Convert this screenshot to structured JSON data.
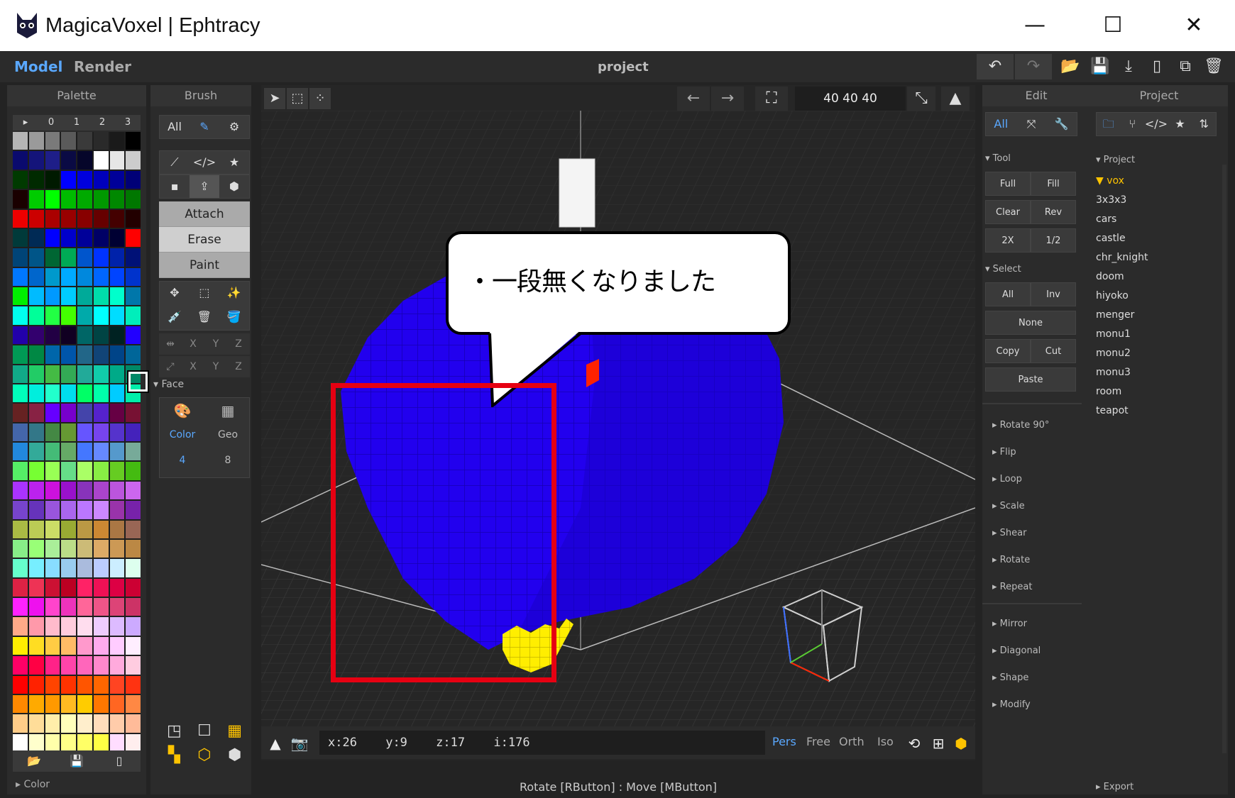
{
  "window": {
    "title": "MagicaVoxel | Ephtracy",
    "minimize": "—",
    "maximize": "☐",
    "close": "✕"
  },
  "menubar": {
    "tab_model": "Model",
    "tab_render": "Render",
    "project_name": "project"
  },
  "palette": {
    "title": "Palette",
    "header": [
      "▸",
      "0",
      "1",
      "2",
      "3"
    ],
    "color_label": "▸ Color",
    "swatches": [
      "#b5b5b5",
      "#9a9a9a",
      "#7a7a7a",
      "#5a5a5a",
      "#3a3a3a",
      "#2a2a2a",
      "#1a1a1a",
      "#000000",
      "#0a0a6e",
      "#14147a",
      "#1e1e88",
      "#0a0a44",
      "#06062a",
      "#ffffff",
      "#e6e6e6",
      "#cccccc",
      "#003a00",
      "#002a00",
      "#001a00",
      "#0000ff",
      "#0000dd",
      "#0000bb",
      "#000099",
      "#000077",
      "#1a0000",
      "#00cc00",
      "#00ff00",
      "#00bb00",
      "#00aa00",
      "#009900",
      "#008800",
      "#007700",
      "#ee0000",
      "#cc0000",
      "#aa0000",
      "#990000",
      "#880000",
      "#660000",
      "#440000",
      "#220000",
      "#003a3a",
      "#002a55",
      "#0000ff",
      "#0000cc",
      "#000099",
      "#000066",
      "#000033",
      "#ff0000",
      "#004477",
      "#005588",
      "#006633",
      "#00aa55",
      "#0055cc",
      "#0033ff",
      "#0022aa",
      "#001177",
      "#0077ff",
      "#0066cc",
      "#0099cc",
      "#00aaff",
      "#0088dd",
      "#0066ff",
      "#0044ff",
      "#0033cc",
      "#00ee00",
      "#00bbff",
      "#0099ff",
      "#00ccff",
      "#00aa99",
      "#00ddaa",
      "#00ffcc",
      "#0077aa",
      "#00ffee",
      "#00ff99",
      "#22ff44",
      "#44ff00",
      "#00aaaa",
      "#00ffff",
      "#00ddff",
      "#00eebb",
      "#2200aa",
      "#33006e",
      "#220044",
      "#110022",
      "#006666",
      "#004444",
      "#002222",
      "#2200ff",
      "#009955",
      "#008844",
      "#0066aa",
      "#0055aa",
      "#226688",
      "#114477",
      "#004488",
      "#006699",
      "#11aa88",
      "#22cc66",
      "#44bb44",
      "#33aa55",
      "#22aa99",
      "#11ccaa",
      "#00aa88",
      "#008866",
      "#00ffbb",
      "#00eedd",
      "#22ffcc",
      "#00ddee",
      "#00ff66",
      "#00ffaa",
      "#00ccff",
      "#00eeaa",
      "#662222",
      "#882244",
      "#6600ff",
      "#7700cc",
      "#4444aa",
      "#5522cc",
      "#660044",
      "#771133",
      "#4466aa",
      "#337788",
      "#448844",
      "#669933",
      "#6655ff",
      "#7744ee",
      "#5533cc",
      "#4422bb",
      "#2288dd",
      "#33aa99",
      "#44bb77",
      "#66aa66",
      "#4477ff",
      "#6688ff",
      "#5599cc",
      "#77aa99",
      "#55ee66",
      "#77ff33",
      "#99ff55",
      "#66dd88",
      "#aaff66",
      "#88ee44",
      "#66cc22",
      "#44bb11",
      "#aa33ff",
      "#bb22ee",
      "#cc11dd",
      "#9911cc",
      "#8833bb",
      "#aa44cc",
      "#bb55dd",
      "#cc66ee",
      "#7744cc",
      "#6633bb",
      "#9955dd",
      "#aa66ee",
      "#bb77ff",
      "#cc88ff",
      "#9933aa",
      "#7722aa",
      "#aabb44",
      "#bbcc55",
      "#ccdd66",
      "#99aa33",
      "#bb9944",
      "#cc8833",
      "#aa7744",
      "#996655",
      "#88ee88",
      "#99ff77",
      "#aaee99",
      "#bbdd88",
      "#ccbb77",
      "#ddaa66",
      "#cc9955",
      "#bb8844",
      "#66ffcc",
      "#77eeff",
      "#88ddff",
      "#99ccee",
      "#aabbdd",
      "#bbccff",
      "#cceeff",
      "#ddffee",
      "#dd2244",
      "#ee3355",
      "#cc1133",
      "#bb0022",
      "#ff2266",
      "#ee1155",
      "#dd0044",
      "#cc0033",
      "#ff22ff",
      "#ee11ee",
      "#ff44cc",
      "#ee33bb",
      "#ff6699",
      "#ee5588",
      "#dd4477",
      "#cc3366",
      "#ffaa88",
      "#ff99aa",
      "#ffbbcc",
      "#ffccdd",
      "#ffddee",
      "#eeccff",
      "#ddbbff",
      "#ccaaff",
      "#ffee00",
      "#ffdd22",
      "#ffcc44",
      "#ffbb66",
      "#ff99cc",
      "#ffaaee",
      "#ffccff",
      "#ffeeff",
      "#ff0066",
      "#ff0044",
      "#ff2288",
      "#ff44aa",
      "#ff66bb",
      "#ff88cc",
      "#ffaadd",
      "#ffcce0",
      "#ff0000",
      "#ff2200",
      "#ff4400",
      "#ff3300",
      "#ff5500",
      "#ff6600",
      "#ff4422",
      "#ff3311",
      "#ff8800",
      "#ffaa00",
      "#ff9900",
      "#ffbb22",
      "#ffcc00",
      "#ff7700",
      "#ff6622",
      "#ff8844",
      "#ffcc88",
      "#ffdd99",
      "#ffeeaa",
      "#ffffbb",
      "#ffeecc",
      "#ffddbb",
      "#ffccaa",
      "#ffbb99",
      "#ffffff",
      "#ffffcc",
      "#ffffaa",
      "#ffff88",
      "#ffff66",
      "#ffff44",
      "#ffddff",
      "#ffeeee"
    ]
  },
  "brush": {
    "title": "Brush",
    "all": "All",
    "modes": [
      "Attach",
      "Erase",
      "Paint"
    ],
    "axis_x": "X",
    "axis_y": "Y",
    "axis_z": "Z",
    "face_label": "▾ Face",
    "face_color": "Color",
    "face_geo": "Geo",
    "face_color_value": "4",
    "face_geo_value": "8"
  },
  "viewport": {
    "size": "40  40  40",
    "callout": "・一段無くなりました",
    "coords": {
      "x": "x:26",
      "y": "y:9",
      "z": "z:17",
      "i": "i:176"
    },
    "view_modes": [
      "Pers",
      "Free",
      "Orth",
      "Iso"
    ],
    "active_view": "Pers",
    "hint": "Rotate [RButton] : Move [MButton]"
  },
  "edit": {
    "title": "Edit",
    "all": "All",
    "tool_group": "▾ Tool",
    "select_group": "▾ Select",
    "tool_buttons": [
      "Full",
      "Fill",
      "Clear",
      "Rev",
      "2X",
      "1/2"
    ],
    "select_buttons": [
      "All",
      "Inv",
      "None",
      "Copy",
      "Cut",
      "Paste"
    ],
    "transforms": [
      "▸ Rotate 90°",
      "▸ Flip",
      "▸ Loop",
      "▸ Scale",
      "▸ Shear",
      "▸ Rotate",
      "▸ Repeat"
    ],
    "generators": [
      "▸ Mirror",
      "▸ Diagonal",
      "▸ Shape",
      "▸ Modify"
    ]
  },
  "project": {
    "title": "Project",
    "group": "▾ Project",
    "files": [
      "▼ vox",
      "3x3x3",
      "cars",
      "castle",
      "chr_knight",
      "doom",
      "hiyoko",
      "menger",
      "monu1",
      "monu2",
      "monu3",
      "room",
      "teapot"
    ],
    "selected": "▼ vox",
    "export": "▸ Export"
  },
  "colors": {
    "accent": "#5aa8ff",
    "highlight_box": "#e60012",
    "voxel_main": "#2200ee",
    "voxel_yellow": "#ffee00"
  }
}
